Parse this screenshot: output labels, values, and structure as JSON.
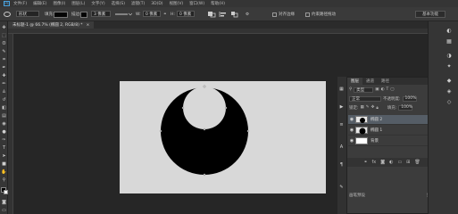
{
  "menubar": {
    "logo": "Ps",
    "items": [
      "文件(F)",
      "编辑(E)",
      "图像(I)",
      "图层(L)",
      "文字(Y)",
      "选择(S)",
      "滤镜(T)",
      "3D(D)",
      "视图(V)",
      "窗口(W)",
      "帮助(H)"
    ]
  },
  "options": {
    "shape_mode": "形状",
    "fill_label": "填充:",
    "stroke_label": "描边:",
    "stroke_size": "3 像素",
    "w_label": "W:",
    "w_value": "0 像素",
    "h_label": "H:",
    "h_value": "0 像素",
    "align_edges": "对齐边缘",
    "constrain": "约束路径拖动",
    "workspace": "基本功能"
  },
  "document_tab": "未标题-1 @ 66.7% (椭圆 2, RGB/8) *",
  "colors": {
    "bg": "#2b2b2b",
    "canvas": "#d8d8d8",
    "shape": "#000000",
    "accent": "#4aa3df"
  },
  "layers_panel": {
    "tabs": [
      "图层",
      "通道",
      "路径"
    ],
    "kind_label": "类型",
    "blend_mode": "正常",
    "opacity_label": "不透明度:",
    "opacity": "100%",
    "lock_label": "锁定:",
    "fill_label": "填充:",
    "fill": "100%",
    "layers": [
      {
        "name": "椭圆 2",
        "selected": true,
        "thumb": "shape"
      },
      {
        "name": "椭圆 1",
        "selected": false,
        "thumb": "shape"
      },
      {
        "name": "背景",
        "selected": false,
        "thumb": "white"
      }
    ]
  },
  "bottom_labels": {
    "left": "画笔预设",
    "right": "剪贴"
  }
}
